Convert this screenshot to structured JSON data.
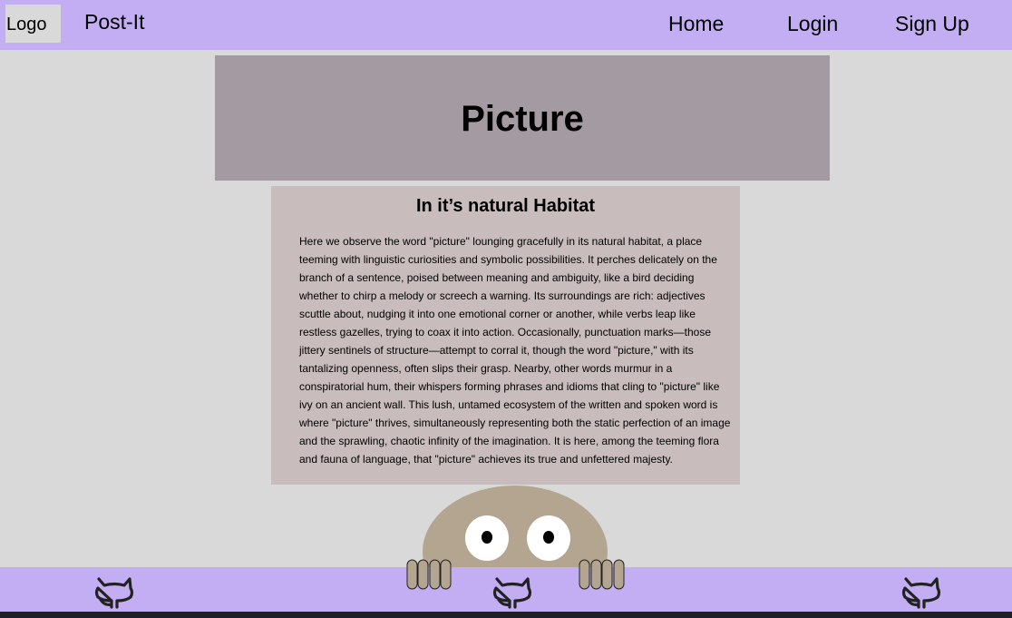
{
  "navbar": {
    "logo": "Logo",
    "brand": "Post-It",
    "links": [
      "Home",
      "Login",
      "Sign Up"
    ]
  },
  "hero": {
    "title": "Picture"
  },
  "card": {
    "title": "In it’s natural Habitat",
    "body": "Here we observe the word \"picture\" lounging gracefully in its natural habitat, a place teeming with linguistic curiosities and symbolic possibilities. It perches delicately on the branch of a sentence, poised between meaning and ambiguity, like a bird deciding whether to chirp a melody or screech a warning. Its surroundings are rich: adjectives scuttle about, nudging it into one emotional corner or another, while verbs leap like restless gazelles, trying to coax it into action. Occasionally, punctuation marks—those jittery sentinels of structure—attempt to corral it, though the word \"picture,\" with its tantalizing openness, often slips their grasp. Nearby, other words murmur in a conspiratorial hum, their whispers forming phrases and idioms that cling to \"picture\" like ivy on an ancient wall. This lush, untamed ecosystem of the written and spoken word is where \"picture\" thrives, simultaneously representing both the static perfection of an image and the sprawling, chaotic infinity of the imagination. It is here, among the teeming flora and fauna of language, that \"picture\" achieves its true and unfettered majesty."
  },
  "footer": {
    "icons": [
      "github-icon",
      "github-icon",
      "github-icon"
    ]
  },
  "colors": {
    "navbar": "#c4aef3",
    "background": "#d9d9d9",
    "hero": "#a49aa2",
    "card": "#c8bcbc",
    "mascot": "#b4a590",
    "bottom_strip": "#1f1f27"
  }
}
